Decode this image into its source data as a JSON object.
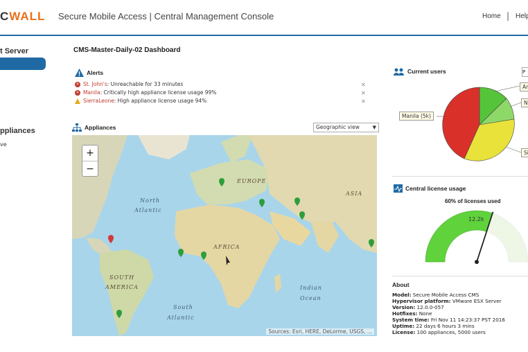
{
  "header": {
    "logo_text_a": "C",
    "logo_text_b": "WALL",
    "app_title": "Secure Mobile Access | Central Management Console",
    "nav_home": "Home",
    "nav_sep": "|",
    "nav_help": "Help"
  },
  "sidebar": {
    "title": "t Server",
    "section": "ppliances",
    "sub_item": "ve"
  },
  "dashboard": {
    "title": "CMS-Master-Daily-02 Dashboard"
  },
  "alerts": {
    "title": "Alerts",
    "items": [
      {
        "site": "St. John's",
        "message": ": Unreachable for 33 minutes",
        "level": "error"
      },
      {
        "site": "Manila",
        "message": ": Critically high appliance license usage 99%",
        "level": "error"
      },
      {
        "site": "SierraLeone",
        "message": ": High appliance license usage 94%",
        "level": "warning"
      }
    ]
  },
  "appliances": {
    "title": "Appliances",
    "view_select": "Geographic view",
    "map_credit": "Sources: Esri, HERE, DeLorme, USGS, ...",
    "zoom_in": "+",
    "zoom_out": "−",
    "labels": {
      "europe": "EUROPE",
      "asia": "ASIA",
      "north_atlantic_1": "North",
      "north_atlantic_2": "Atlantic",
      "africa": "AFRICA",
      "south_america_1": "SOUTH",
      "south_america_2": "AMERICA",
      "indian_1": "Indian",
      "indian_2": "Ocean",
      "south_atlantic_1": "South",
      "south_atlantic_2": "Atlantic"
    }
  },
  "current_users": {
    "title": "Current users",
    "select_value": "P",
    "labels": {
      "manila": "Manila (5k)",
      "label_a": "Ar",
      "label_n": "N",
      "label_si": "Si"
    }
  },
  "license": {
    "title": "Central license usage",
    "subtitle": "60% of licenses used",
    "value_label": "12.2k",
    "used_fraction": 0.6
  },
  "about": {
    "title": "About",
    "rows": [
      {
        "key": "Model:",
        "value": "Secure Mobile Access CMS"
      },
      {
        "key": "Hypervisor platform:",
        "value": "VMware ESX Server"
      },
      {
        "key": "Version:",
        "value": "12.0.0-057"
      },
      {
        "key": "Hotfixes:",
        "value": "None"
      },
      {
        "key": "System time:",
        "value": "Fri Nov 11 14:23:37 PST 2016"
      },
      {
        "key": "Uptime:",
        "value": "22 days 6 hours 3 mins"
      },
      {
        "key": "License:",
        "value": "100 appliances, 5000 users"
      }
    ]
  },
  "colors": {
    "accent": "#1f6aa5",
    "logo_accent": "#e8701a",
    "pie_red": "#d9302a",
    "pie_green": "#56c43a",
    "pie_yellow": "#e8e23a",
    "gauge_green": "#5fd23c"
  }
}
